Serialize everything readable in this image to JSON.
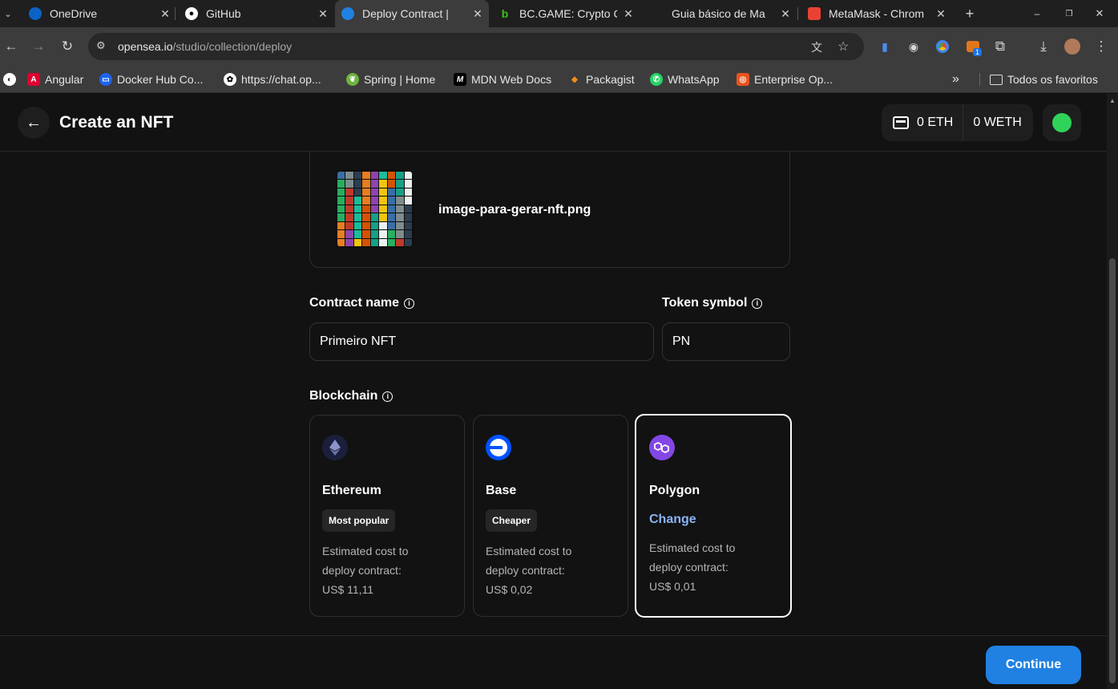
{
  "browser": {
    "tabs": [
      {
        "title": "OneDrive",
        "icon": "onedrive-icon"
      },
      {
        "title": "GitHub",
        "icon": "github-icon"
      },
      {
        "title": "Deploy Contract | ",
        "icon": "opensea-icon"
      },
      {
        "title": "BC.GAME: Crypto C",
        "icon": "bcgame-icon"
      },
      {
        "title": "Guia básico de Ma",
        "icon": "none"
      },
      {
        "title": "MetaMask - Chrom",
        "icon": "webstore-icon"
      }
    ],
    "url": {
      "host": "opensea.io",
      "path": "/studio/collection/deploy"
    },
    "extension_badge": "1",
    "bookmarks": [
      {
        "label": "Angular"
      },
      {
        "label": "Docker Hub Co..."
      },
      {
        "label": "https://chat.op..."
      },
      {
        "label": "Spring | Home"
      },
      {
        "label": "MDN Web Docs"
      },
      {
        "label": "Packagist"
      },
      {
        "label": "WhatsApp"
      },
      {
        "label": "Enterprise Op..."
      }
    ],
    "all_bookmarks": "Todos os favoritos"
  },
  "header": {
    "title": "Create an NFT",
    "eth_balance": "0 ETH",
    "weth_balance": "0 WETH"
  },
  "file": {
    "name": "image-para-gerar-nft.png"
  },
  "form": {
    "contract_name_label": "Contract name",
    "contract_name_value": "Primeiro NFT",
    "token_symbol_label": "Token symbol",
    "token_symbol_value": "PN",
    "blockchain_label": "Blockchain"
  },
  "chains": [
    {
      "name": "Ethereum",
      "badge": "Most popular",
      "cost_line1": "Estimated cost to",
      "cost_line2": "deploy contract:",
      "cost_line3": "US$ 11,11",
      "color": "#1c1f3b"
    },
    {
      "name": "Base",
      "badge": "Cheaper",
      "cost_line1": "Estimated cost to",
      "cost_line2": "deploy contract:",
      "cost_line3": "US$ 0,02",
      "color": "#0052ff"
    },
    {
      "name": "Polygon",
      "change": "Change",
      "cost_line1": "Estimated cost to",
      "cost_line2": "deploy contract:",
      "cost_line3": "US$ 0,01",
      "color": "#8247e5",
      "selected": true
    }
  ],
  "footer": {
    "continue_label": "Continue"
  },
  "colors": {
    "accent": "#2081e2",
    "link": "#8ab4f8",
    "status_dot": "#2fd35a"
  }
}
